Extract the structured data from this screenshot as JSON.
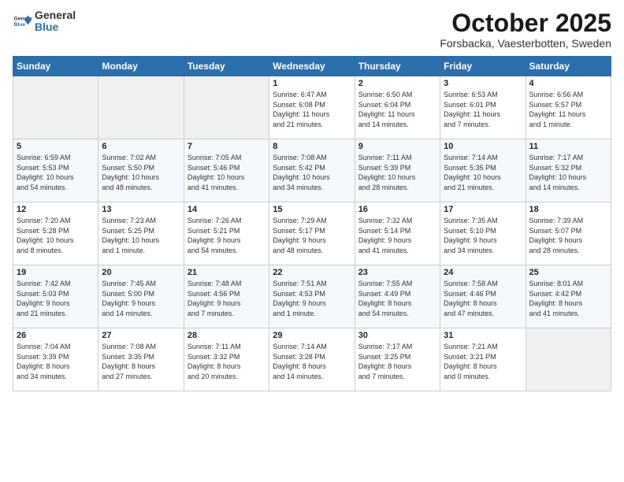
{
  "header": {
    "logo_general": "General",
    "logo_blue": "Blue",
    "month": "October 2025",
    "location": "Forsbacka, Vaesterbotten, Sweden"
  },
  "weekdays": [
    "Sunday",
    "Monday",
    "Tuesday",
    "Wednesday",
    "Thursday",
    "Friday",
    "Saturday"
  ],
  "weeks": [
    [
      {
        "day": "",
        "info": ""
      },
      {
        "day": "",
        "info": ""
      },
      {
        "day": "",
        "info": ""
      },
      {
        "day": "1",
        "info": "Sunrise: 6:47 AM\nSunset: 6:08 PM\nDaylight: 11 hours\nand 21 minutes."
      },
      {
        "day": "2",
        "info": "Sunrise: 6:50 AM\nSunset: 6:04 PM\nDaylight: 11 hours\nand 14 minutes."
      },
      {
        "day": "3",
        "info": "Sunrise: 6:53 AM\nSunset: 6:01 PM\nDaylight: 11 hours\nand 7 minutes."
      },
      {
        "day": "4",
        "info": "Sunrise: 6:56 AM\nSunset: 5:57 PM\nDaylight: 11 hours\nand 1 minute."
      }
    ],
    [
      {
        "day": "5",
        "info": "Sunrise: 6:59 AM\nSunset: 5:53 PM\nDaylight: 10 hours\nand 54 minutes."
      },
      {
        "day": "6",
        "info": "Sunrise: 7:02 AM\nSunset: 5:50 PM\nDaylight: 10 hours\nand 48 minutes."
      },
      {
        "day": "7",
        "info": "Sunrise: 7:05 AM\nSunset: 5:46 PM\nDaylight: 10 hours\nand 41 minutes."
      },
      {
        "day": "8",
        "info": "Sunrise: 7:08 AM\nSunset: 5:42 PM\nDaylight: 10 hours\nand 34 minutes."
      },
      {
        "day": "9",
        "info": "Sunrise: 7:11 AM\nSunset: 5:39 PM\nDaylight: 10 hours\nand 28 minutes."
      },
      {
        "day": "10",
        "info": "Sunrise: 7:14 AM\nSunset: 5:35 PM\nDaylight: 10 hours\nand 21 minutes."
      },
      {
        "day": "11",
        "info": "Sunrise: 7:17 AM\nSunset: 5:32 PM\nDaylight: 10 hours\nand 14 minutes."
      }
    ],
    [
      {
        "day": "12",
        "info": "Sunrise: 7:20 AM\nSunset: 5:28 PM\nDaylight: 10 hours\nand 8 minutes."
      },
      {
        "day": "13",
        "info": "Sunrise: 7:23 AM\nSunset: 5:25 PM\nDaylight: 10 hours\nand 1 minute."
      },
      {
        "day": "14",
        "info": "Sunrise: 7:26 AM\nSunset: 5:21 PM\nDaylight: 9 hours\nand 54 minutes."
      },
      {
        "day": "15",
        "info": "Sunrise: 7:29 AM\nSunset: 5:17 PM\nDaylight: 9 hours\nand 48 minutes."
      },
      {
        "day": "16",
        "info": "Sunrise: 7:32 AM\nSunset: 5:14 PM\nDaylight: 9 hours\nand 41 minutes."
      },
      {
        "day": "17",
        "info": "Sunrise: 7:35 AM\nSunset: 5:10 PM\nDaylight: 9 hours\nand 34 minutes."
      },
      {
        "day": "18",
        "info": "Sunrise: 7:39 AM\nSunset: 5:07 PM\nDaylight: 9 hours\nand 28 minutes."
      }
    ],
    [
      {
        "day": "19",
        "info": "Sunrise: 7:42 AM\nSunset: 5:03 PM\nDaylight: 9 hours\nand 21 minutes."
      },
      {
        "day": "20",
        "info": "Sunrise: 7:45 AM\nSunset: 5:00 PM\nDaylight: 9 hours\nand 14 minutes."
      },
      {
        "day": "21",
        "info": "Sunrise: 7:48 AM\nSunset: 4:56 PM\nDaylight: 9 hours\nand 7 minutes."
      },
      {
        "day": "22",
        "info": "Sunrise: 7:51 AM\nSunset: 4:53 PM\nDaylight: 9 hours\nand 1 minute."
      },
      {
        "day": "23",
        "info": "Sunrise: 7:55 AM\nSunset: 4:49 PM\nDaylight: 8 hours\nand 54 minutes."
      },
      {
        "day": "24",
        "info": "Sunrise: 7:58 AM\nSunset: 4:46 PM\nDaylight: 8 hours\nand 47 minutes."
      },
      {
        "day": "25",
        "info": "Sunrise: 8:01 AM\nSunset: 4:42 PM\nDaylight: 8 hours\nand 41 minutes."
      }
    ],
    [
      {
        "day": "26",
        "info": "Sunrise: 7:04 AM\nSunset: 3:39 PM\nDaylight: 8 hours\nand 34 minutes."
      },
      {
        "day": "27",
        "info": "Sunrise: 7:08 AM\nSunset: 3:35 PM\nDaylight: 8 hours\nand 27 minutes."
      },
      {
        "day": "28",
        "info": "Sunrise: 7:11 AM\nSunset: 3:32 PM\nDaylight: 8 hours\nand 20 minutes."
      },
      {
        "day": "29",
        "info": "Sunrise: 7:14 AM\nSunset: 3:28 PM\nDaylight: 8 hours\nand 14 minutes."
      },
      {
        "day": "30",
        "info": "Sunrise: 7:17 AM\nSunset: 3:25 PM\nDaylight: 8 hours\nand 7 minutes."
      },
      {
        "day": "31",
        "info": "Sunrise: 7:21 AM\nSunset: 3:21 PM\nDaylight: 8 hours\nand 0 minutes."
      },
      {
        "day": "",
        "info": ""
      }
    ]
  ]
}
